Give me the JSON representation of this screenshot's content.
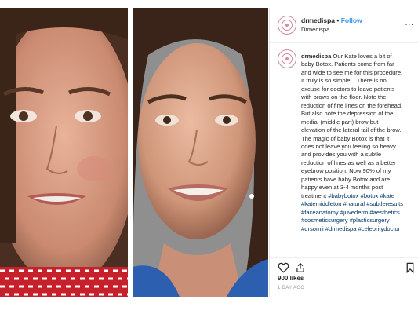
{
  "account": {
    "username": "drmedispa",
    "separator": "•",
    "follow_label": "Follow",
    "subtitle": "Drmedispa",
    "more_label": "..."
  },
  "caption": {
    "username": "drmedispa",
    "lines": [
      " Our Kate loves a bit of",
      "baby Botox. Patients come from far",
      "and wide to see me for this procedure.",
      "It truly is so simple... There is no",
      "excuse for doctors to leave patients",
      "with brows on the floor. Note the",
      "reduction of fine lines on the forehead.",
      "But also note the depression of the",
      "medial (middle part) brow but",
      "elevation of the lateral tail of the brow.",
      "The magic of baby Botox is that it",
      "does not leave you feeling so heavy",
      "and provides you with a subtle",
      "reduction of lines as well as a better",
      "eyebrow position. Now 90% of my",
      "patients have baby Botox and are",
      "happy even at 3-4 months post",
      "treatment "
    ],
    "hashtags": [
      [
        "#babybotox",
        "#botox",
        "#kate"
      ],
      [
        "#katemiddleton",
        "#natural",
        "#subtleresults"
      ],
      [
        "#faceanatomy",
        "#juvederm",
        "#aesthetics"
      ],
      [
        "#cosmeticsurgery",
        "#plasticsurgery"
      ],
      [
        "#drsomji",
        "#drmedispa",
        "#celebritydoctor"
      ]
    ]
  },
  "stats": {
    "likes": "900 likes",
    "time_ago": "1 DAY AGO"
  },
  "icons": {
    "like": "heart-icon",
    "share": "share-icon",
    "save": "bookmark-icon",
    "avatar": "profile-avatar"
  },
  "colors": {
    "follow": "#3897f0",
    "hashtag": "#003569",
    "text": "#262626",
    "muted": "#999999",
    "avatar_ring": "#d58ca1"
  }
}
